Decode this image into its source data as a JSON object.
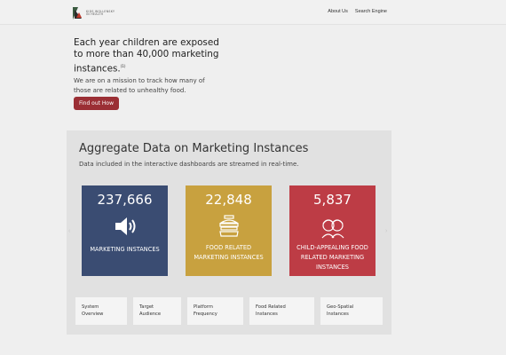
{
  "header": {
    "logo_line1": "KIDS WOLLENSKY",
    "logo_line2": "IN HEALTH",
    "nav": [
      "About Us",
      "Search Engine"
    ]
  },
  "hero": {
    "title": "Each year children are exposed to more than 40,000 marketing instances.",
    "footnote": "(1)",
    "subtitle": "We are on a mission to track how many of those are related to unhealthy food.",
    "button": "Find out How"
  },
  "panel": {
    "title": "Aggregate Data on Marketing Instances",
    "subtitle": "Data included in the interactive dashboards are streamed in real-time.",
    "cards": [
      {
        "number": "237,666",
        "label": "MARKETING INSTANCES",
        "icon": "speaker-icon",
        "color": "#3a4c72"
      },
      {
        "number": "22,848",
        "label": "FOOD RELATED MARKETING INSTANCES",
        "icon": "fast-food-icon",
        "color": "#c8a13f"
      },
      {
        "number": "5,837",
        "label": "CHILD-APPEALING FOOD RELATED MARKETING INSTANCES",
        "icon": "children-icon",
        "color": "#bd3c45"
      }
    ],
    "arrows": {
      "left": "‹",
      "right": "›"
    },
    "tabs": [
      {
        "line1": "System",
        "line2": "Overview"
      },
      {
        "line1": "Target",
        "line2": "Audience"
      },
      {
        "line1": "Platform",
        "line2": "Frequency"
      },
      {
        "line1": "Food Related",
        "line2": "Instances"
      },
      {
        "line1": "Geo-Spatial",
        "line2": "Instances"
      }
    ]
  }
}
